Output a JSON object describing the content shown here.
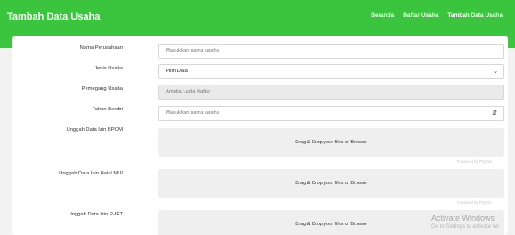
{
  "header": {
    "title": "Tambah Data Usaha",
    "nav": [
      "Beranda",
      "Daftar Usaha",
      "Tambah Data Usaha"
    ]
  },
  "form": {
    "nama_perusahaan": {
      "label": "Nama Perusahaan",
      "placeholder": "Masukkan nama usaha"
    },
    "jenis_usaha": {
      "label": "Jenis Usaha",
      "value": "Pilih Data"
    },
    "pemegang_usaha": {
      "label": "Pemegang Usaha",
      "value": "Amelia Ludia Kafiar"
    },
    "tahun_berdiri": {
      "label": "Tahun Berdiri",
      "placeholder": "Masukkan nama usaha"
    },
    "uploads": [
      {
        "label": "Unggah Data Izin BPOM",
        "drop_text": "Drag & Drop your files or Browse",
        "powered": "Powered by PQINA"
      },
      {
        "label": "Unggah Data Izin Halal MUI",
        "drop_text": "Drag & Drop your files or Browse",
        "powered": "Powered by PQINA"
      },
      {
        "label": "Unggah Data Izin P-IRT",
        "drop_text": "Drag & Drop your files or Browse"
      }
    ]
  },
  "watermark": {
    "line1": "Activate Windows",
    "line2": "Go to Settings to activate Wi"
  },
  "colors": {
    "navbar": "#3bc43e",
    "card": "#ffffff",
    "background": "#f2f2f2"
  }
}
